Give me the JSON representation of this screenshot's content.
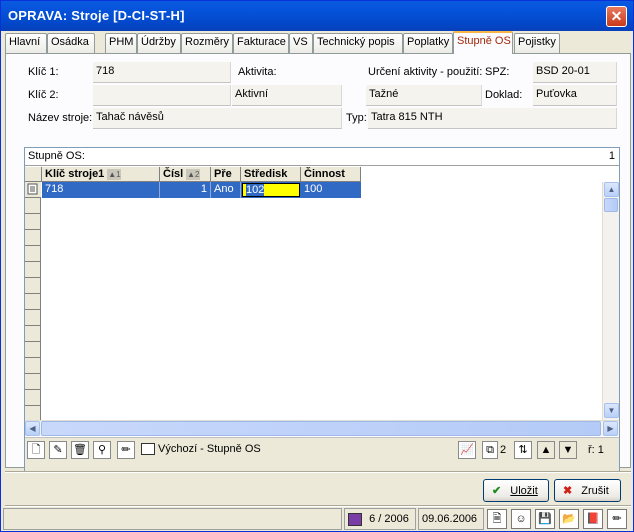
{
  "window": {
    "title": "OPRAVA: Stroje [D-CI-ST-H]",
    "close_glyph": "✕"
  },
  "tabs": [
    {
      "label": "Hlavní"
    },
    {
      "label": "Osádka"
    },
    {
      "label": "PHM"
    },
    {
      "label": "Údržby"
    },
    {
      "label": "Rozměry"
    },
    {
      "label": "Fakturace"
    },
    {
      "label": "VS"
    },
    {
      "label": "Technický popis"
    },
    {
      "label": "Poplatky"
    },
    {
      "label": "Stupně OS",
      "active": true
    },
    {
      "label": "Pojistky"
    }
  ],
  "form": {
    "klic1_label": "Klíč 1:",
    "klic1_value": "718",
    "klic2_label": "Klíč 2:",
    "klic2_value": "",
    "aktivita_label": "Aktivita:",
    "aktivita_value": "Aktivní",
    "urceni_label": "Určení aktivity - použití:",
    "urceni_value": "Tažné",
    "spz_label": "SPZ:",
    "spz_value": "BSD 20-01",
    "doklad_label": "Doklad:",
    "doklad_value": "Puťovka",
    "nazev_label": "Název stroje:",
    "nazev_value": "Tahač návěsů",
    "typ_label": "Typ:",
    "typ_value": "Tatra 815 NTH"
  },
  "grid": {
    "title": "Stupně OS:",
    "count": "1",
    "columns": [
      {
        "label": "Klíč stroje1",
        "sort": "▲1"
      },
      {
        "label": "Čísl",
        "sort": "▲2"
      },
      {
        "label": "Pře",
        "sort": ""
      },
      {
        "label": "Středisk",
        "sort": ""
      },
      {
        "label": "Činnost",
        "sort": ""
      }
    ],
    "rows": [
      {
        "cells": [
          "718",
          "1",
          "Ano",
          "102",
          "100"
        ]
      }
    ],
    "toolbar_view_label": "Výchozí - Stupně OS",
    "count_right": "2",
    "record_label": "ř: 1"
  },
  "buttons": {
    "save_label": "Uložit",
    "cancel_label": "Zrušit"
  },
  "status": {
    "period": "6 / 2006",
    "date": "09.06.2006"
  },
  "colors": {
    "selection": "#316ac5",
    "edit_cell": "#ffff00",
    "active_tab_text": "#a0280a"
  }
}
